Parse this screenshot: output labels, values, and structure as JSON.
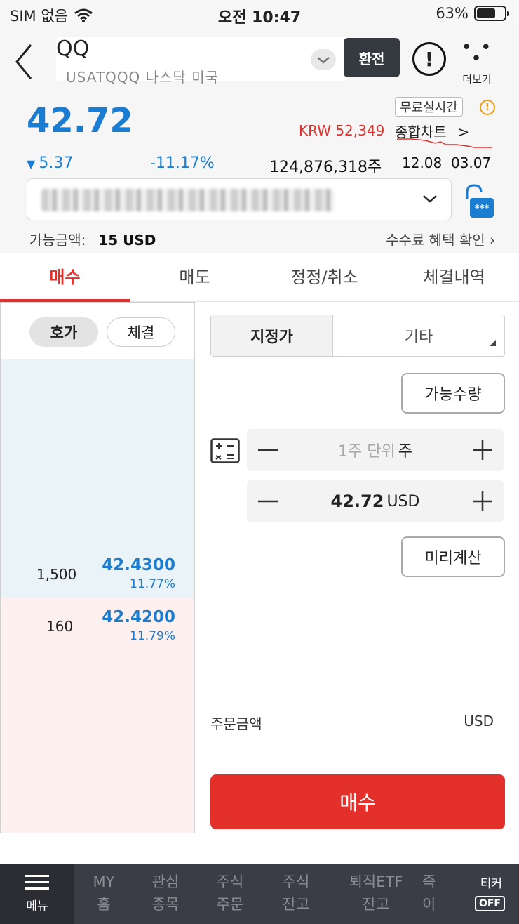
{
  "status_bar": {
    "carrier": "SIM 없음",
    "time": "오전 10:47",
    "battery": "63%"
  },
  "header": {
    "ticker_partial": "QQ",
    "ticker_sub": "USATQQQ 나스닥 미국",
    "exchange_button": "환전",
    "more_label": "더보기"
  },
  "quote": {
    "price": "42.72",
    "krw": "KRW 52,349",
    "free_realtime": "무료실시간",
    "chart_link": "종합차트",
    "change": "5.37",
    "change_rate": "-11.17%",
    "volume": "124,876,318주",
    "dates": "12.08  03.07"
  },
  "account": {
    "available_label": "가능금액:",
    "available_value": "15 USD",
    "fee_link": "수수료 혜택 확인"
  },
  "tabs": [
    {
      "label": "매수"
    },
    {
      "label": "매도"
    },
    {
      "label": "정정/취소"
    },
    {
      "label": "체결내역"
    }
  ],
  "book": {
    "seg_quote": "호가",
    "seg_trade": "체결",
    "rows": [
      {
        "qty": "1,500",
        "price": "42.4300",
        "rate": "11.77%"
      },
      {
        "qty": "160",
        "price": "42.4200",
        "rate": "11.79%"
      }
    ]
  },
  "order": {
    "type_limit": "지정가",
    "type_other": "기타",
    "available_qty_button": "가능수량",
    "qty_placeholder": "1주 단위",
    "qty_unit": "주",
    "price_value": "42.72",
    "price_unit": "USD",
    "precalc_button": "미리계산",
    "amount_label": "주문금액",
    "amount_unit": "USD",
    "buy_button": "매수"
  },
  "bottom_nav": {
    "menu": "메뉴",
    "items": [
      {
        "line1": "MY",
        "line2": "홈"
      },
      {
        "line1": "관심",
        "line2": "종목"
      },
      {
        "line1": "주식",
        "line2": "주문"
      },
      {
        "line1": "주식",
        "line2": "잔고"
      },
      {
        "line1": "퇴직ETF",
        "line2": "잔고"
      },
      {
        "line1": "즉",
        "line2": "이"
      }
    ],
    "ticker_label": "티커",
    "ticker_state": "OFF"
  },
  "colors": {
    "up_blue": "#1a7dd1",
    "accent_red": "#e0312c",
    "nav_bg": "#3a3d45"
  }
}
